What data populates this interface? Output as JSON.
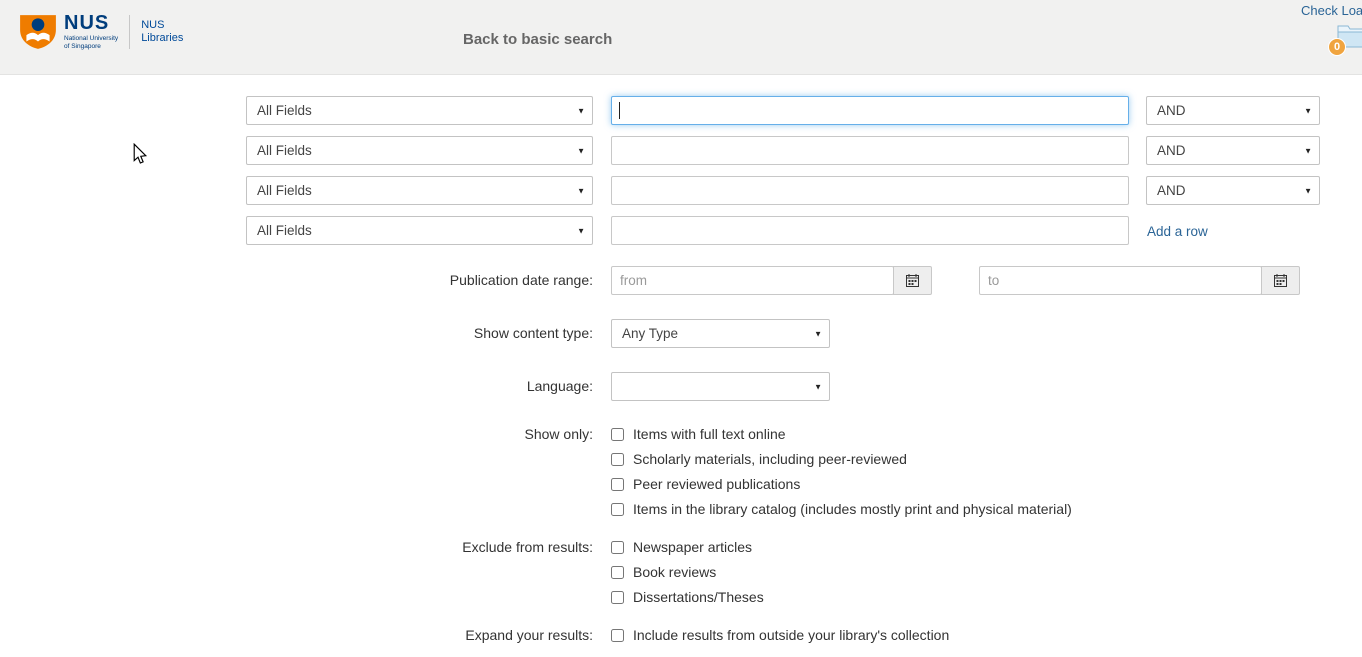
{
  "header": {
    "logo": {
      "acronym": "NUS",
      "tagline1": "National University",
      "tagline2": "of Singapore",
      "lib1": "NUS",
      "lib2": "Libraries"
    },
    "back_link": "Back to basic search",
    "check_loans": "Check Loans",
    "badge_count": "0"
  },
  "search": {
    "rows": [
      {
        "field": "All Fields",
        "value": "",
        "op": "AND"
      },
      {
        "field": "All Fields",
        "value": "",
        "op": "AND"
      },
      {
        "field": "All Fields",
        "value": "",
        "op": "AND"
      },
      {
        "field": "All Fields",
        "value": ""
      }
    ],
    "add_row": "Add a row"
  },
  "filters": {
    "pub_date_label": "Publication date range:",
    "from_placeholder": "from",
    "to_placeholder": "to",
    "content_type_label": "Show content type:",
    "content_type_value": "Any Type",
    "language_label": "Language:",
    "language_value": "",
    "show_only_label": "Show only:",
    "show_only_options": [
      "Items with full text online",
      "Scholarly materials, including peer-reviewed",
      "Peer reviewed publications",
      "Items in the library catalog (includes mostly print and physical material)"
    ],
    "exclude_label": "Exclude from results:",
    "exclude_options": [
      "Newspaper articles",
      "Book reviews",
      "Dissertations/Theses"
    ],
    "expand_label": "Expand your results:",
    "expand_options": [
      "Include results from outside your library's collection"
    ]
  },
  "colors": {
    "link": "#2a6496",
    "header_bg": "#f1f1f0",
    "focus_border": "#66afe9",
    "badge_orange": "#f0a43f",
    "nus_orange": "#ef7c00",
    "nus_blue": "#003d7c"
  }
}
